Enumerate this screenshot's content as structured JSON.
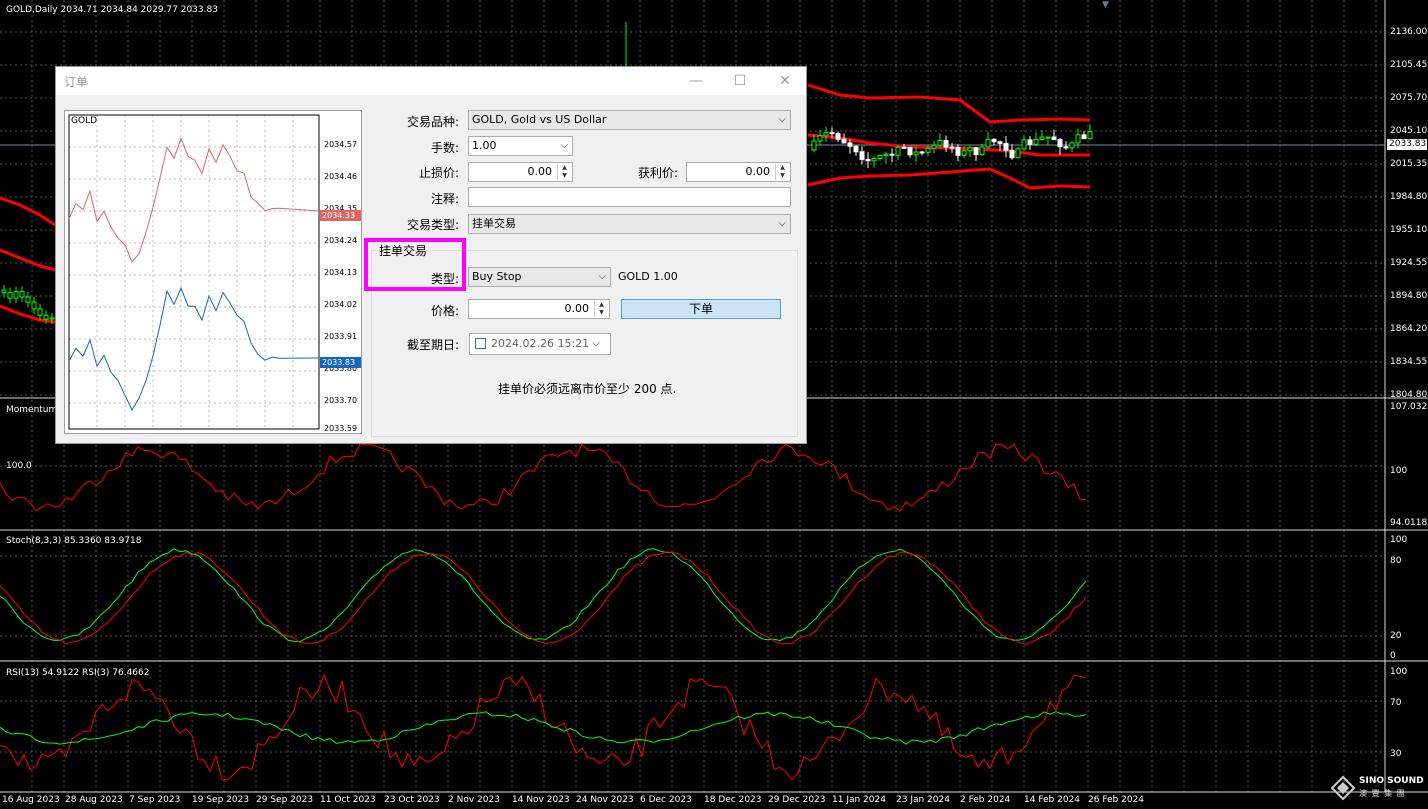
{
  "main_chart": {
    "header": "GOLD,Daily  2034.71 2034.84 2029.77 2033.83",
    "current_price": "2033.83",
    "price_scale": [
      "2136.00",
      "2105.45",
      "2075.70",
      "2045.10",
      "2015.35",
      "1984.80",
      "1955.10",
      "1924.55",
      "1894.80",
      "1864.20",
      "1834.55",
      "1804.80"
    ]
  },
  "momentum_panel": {
    "title": "Momentum",
    "level_label": "100.0",
    "scale": [
      "107.0329",
      "100",
      "94.0118"
    ]
  },
  "stoch_panel": {
    "title": "Stoch(8,3,3) 85.3360 83.9718",
    "scale": [
      "100",
      "80",
      "20",
      "0"
    ]
  },
  "rsi_panel": {
    "title": "RSI(13) 54.9122  RSI(3) 76.4662",
    "scale": [
      "100",
      "70",
      "30"
    ]
  },
  "date_axis": [
    "16 Aug 2023",
    "28 Aug 2023",
    "7 Sep 2023",
    "19 Sep 2023",
    "29 Sep 2023",
    "11 Oct 2023",
    "23 Oct 2023",
    "2 Nov 2023",
    "14 Nov 2023",
    "24 Nov 2023",
    "6 Dec 2023",
    "18 Dec 2023",
    "29 Dec 2023",
    "11 Jan 2024",
    "23 Jan 2024",
    "2 Feb 2024",
    "14 Feb 2024",
    "26 Feb 2024"
  ],
  "watermark": {
    "brand": "SINO SOUND",
    "sub": "澳 豐 集 團"
  },
  "dialog": {
    "title": "订单",
    "minimize": "—",
    "maximize": "☐",
    "close": "✕",
    "mini_chart": {
      "symbol": "GOLD",
      "scale": [
        "2034.57",
        "2034.46",
        "2034.35",
        "2034.24",
        "2034.13",
        "2034.02",
        "2033.91",
        "2033.80",
        "2033.70",
        "2033.59"
      ],
      "ask_tag": "2034.33",
      "bid_tag": "2033.83",
      "ask_color": "#e06666",
      "bid_color": "#1565c0"
    },
    "symbol_label": "交易品种:",
    "symbol_value": "GOLD, Gold vs US Dollar",
    "volume_label": "手数:",
    "volume_value": "1.00",
    "sl_label": "止损价:",
    "sl_value": "0.00",
    "tp_label": "获利价:",
    "tp_value": "0.00",
    "comment_label": "注释:",
    "comment_value": "",
    "type_label": "交易类型:",
    "type_value": "挂单交易",
    "pending_group_title": "挂单交易",
    "order_type_label": "类型:",
    "order_type_value": "Buy Stop",
    "order_summary": "GOLD 1.00",
    "price_label": "价格:",
    "price_value": "0.00",
    "place_button": "下单",
    "expiry_label": "截至期日:",
    "expiry_value": "2024.02.26 15:21",
    "notice": "挂单价必须远离市价至少 200 点."
  }
}
